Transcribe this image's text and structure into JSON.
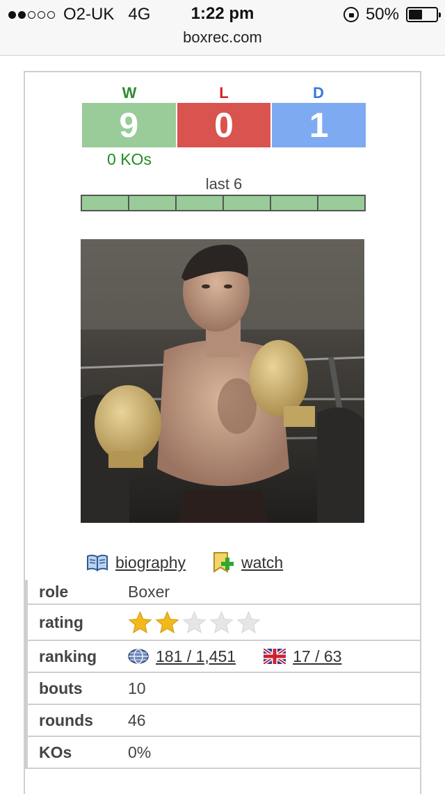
{
  "status_bar": {
    "signal_dots_filled": 2,
    "signal_dots_total": 5,
    "carrier": "O2-UK",
    "network": "4G",
    "time": "1:22 pm",
    "battery": "50%",
    "battery_level": 0.5
  },
  "browser": {
    "url": "boxrec.com"
  },
  "record": {
    "wins_label": "W",
    "losses_label": "L",
    "draws_label": "D",
    "wins": "9",
    "losses": "0",
    "draws": "1",
    "kos": "0 KOs",
    "colors": {
      "win": "#99cc99",
      "loss": "#d9534f",
      "draw": "#7eaaf2"
    }
  },
  "last6": {
    "label": "last 6",
    "results": [
      "win",
      "win",
      "win",
      "win",
      "win",
      "win"
    ]
  },
  "links": {
    "biography": "biography",
    "watch": "watch"
  },
  "icons": {
    "biography": "book-icon",
    "watch": "watchlist-add-icon",
    "world_rank": "globe-icon",
    "uk_rank": "uk-flag-icon"
  },
  "info": {
    "role_label": "role",
    "role": "Boxer",
    "rating_label": "rating",
    "rating_stars": 2,
    "rating_max": 5,
    "ranking_label": "ranking",
    "world_rank": "181 / 1,451",
    "uk_rank": "17 / 63",
    "bouts_label": "bouts",
    "bouts": "10",
    "rounds_label": "rounds",
    "rounds": "46",
    "kos_label": "KOs",
    "kos": "0%"
  }
}
